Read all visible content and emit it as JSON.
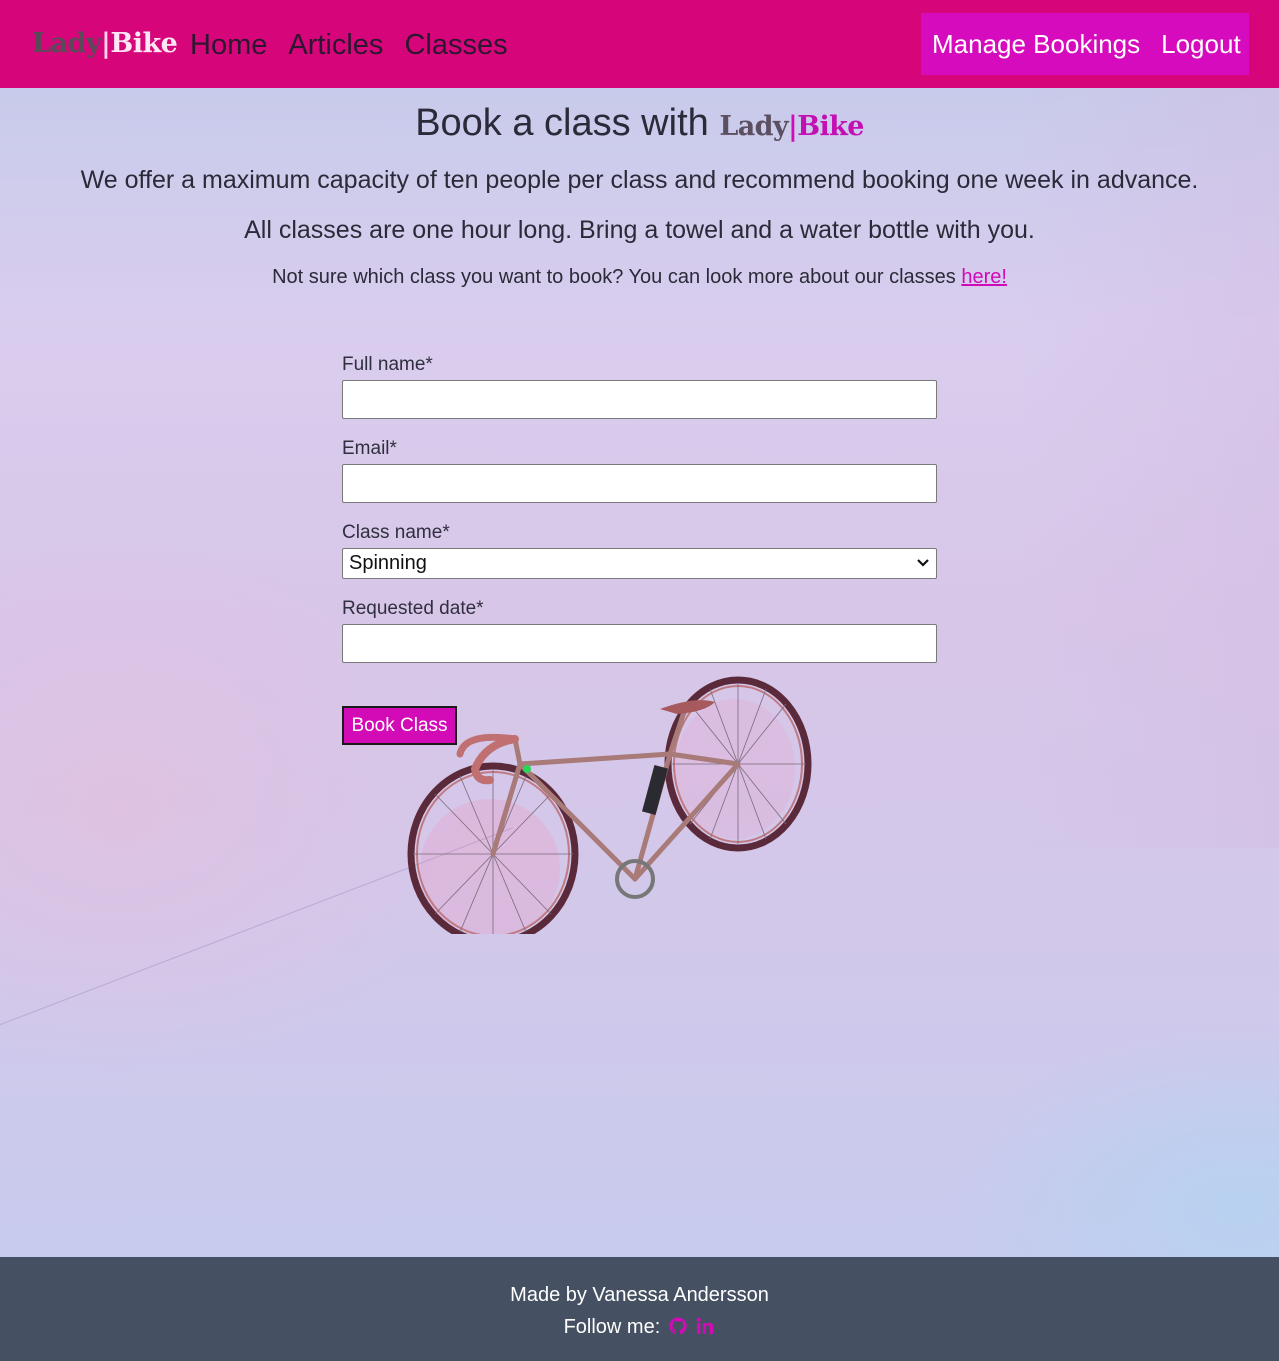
{
  "navbar": {
    "brand": {
      "lady": "Lady",
      "bar": "|",
      "bike": "Bike"
    },
    "links": [
      "Home",
      "Articles",
      "Classes"
    ],
    "right_links": [
      "Manage Bookings",
      "Logout"
    ]
  },
  "page": {
    "title": "Book a class with",
    "title_brand": {
      "lady": "Lady",
      "bar": "|",
      "bike": "Bike"
    },
    "lead1": "We offer a maximum capacity of ten people per class and recommend booking one week in advance.",
    "lead2": "All classes are one hour long. Bring a towel and a water bottle with you.",
    "note_text": "Not sure which class you want to book? You can look more about our classes ",
    "note_link": "here!"
  },
  "form": {
    "full_name_label": "Full name*",
    "full_name_value": "",
    "email_label": "Email*",
    "email_value": "",
    "class_name_label": "Class name*",
    "class_name_selected": "Spinning",
    "requested_date_label": "Requested date*",
    "requested_date_value": "",
    "submit_label": "Book Class"
  },
  "footer": {
    "made_by": "Made by Vanessa Andersson",
    "follow": "Follow me:",
    "icons": [
      "github-icon",
      "linkedin-icon"
    ]
  },
  "colors": {
    "navbar_bg": "#d6067a",
    "nav_right_bg": "#d60bbd",
    "accent": "#d20bb7",
    "footer_bg": "#455162"
  }
}
